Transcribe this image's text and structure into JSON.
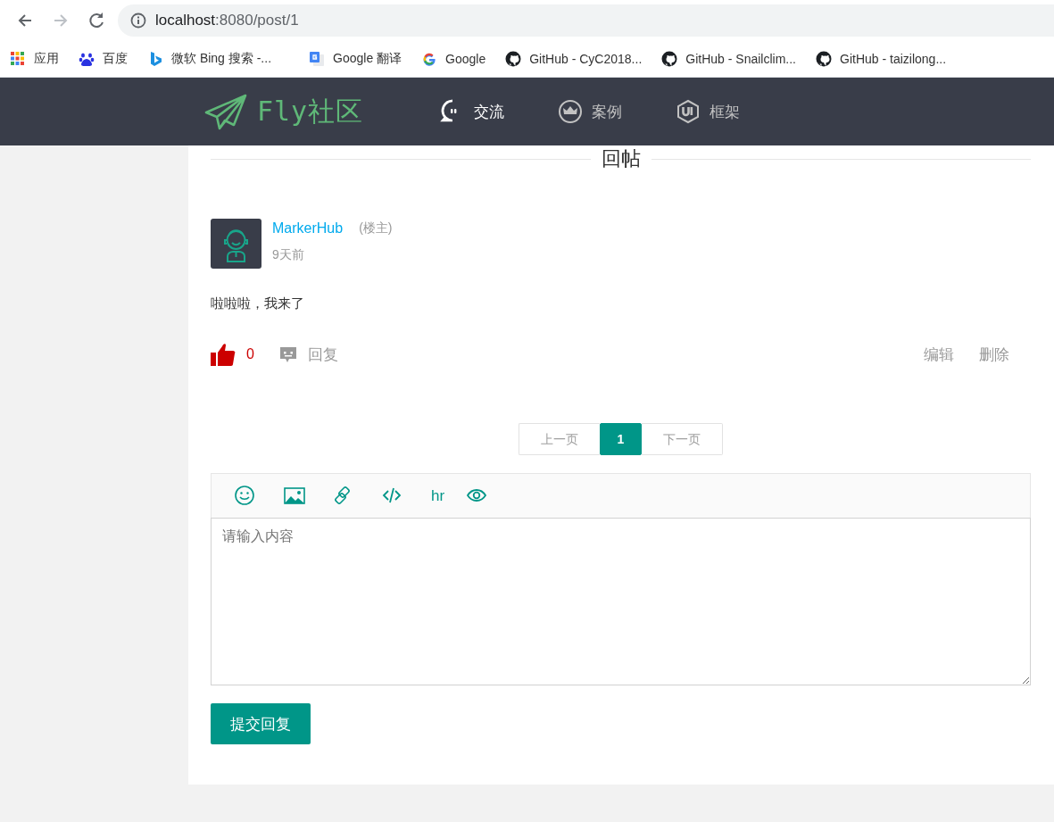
{
  "browser": {
    "nav_buttons": [
      {
        "kind": "back",
        "disabled": false
      },
      {
        "kind": "forward",
        "disabled": true
      },
      {
        "kind": "reload",
        "disabled": false
      }
    ],
    "url_host": "localhost",
    "url_rest": ":8080/post/1",
    "bookmarks": [
      {
        "kind": "apps",
        "label": "应用"
      },
      {
        "kind": "paw",
        "label": "百度"
      },
      {
        "kind": "bing",
        "label": "微软 Bing 搜索 -..."
      },
      {
        "kind": "translate",
        "label": "Google 翻译"
      },
      {
        "kind": "google",
        "label": "Google"
      },
      {
        "kind": "github",
        "label": "GitHub - CyC2018..."
      },
      {
        "kind": "github",
        "label": "GitHub - Snailclim..."
      },
      {
        "kind": "github",
        "label": "GitHub - taizilong..."
      }
    ]
  },
  "header": {
    "logo": "Fly社区",
    "nav": [
      {
        "kind": "chat",
        "label": "交流",
        "selected": true
      },
      {
        "kind": "crown",
        "label": "案例",
        "selected": false
      },
      {
        "kind": "ui",
        "label": "框架",
        "selected": false
      }
    ]
  },
  "section_title": "回帖",
  "comment": {
    "author": "MarkerHub",
    "badge": "(楼主)",
    "time": "9天前",
    "content": "啦啦啦，我来了",
    "likes": "0",
    "reply": "回复",
    "actions": [
      "编辑",
      "删除"
    ]
  },
  "pagination": {
    "prev": {
      "label": "上一页",
      "disabled": true
    },
    "pages": [
      {
        "label": "1",
        "selected": true
      }
    ],
    "next": {
      "label": "下一页",
      "disabled": true
    }
  },
  "editor": {
    "tools": [
      {
        "kind": "emoji"
      },
      {
        "kind": "image"
      },
      {
        "kind": "link"
      },
      {
        "kind": "code"
      },
      {
        "kind": "text",
        "label": "hr"
      },
      {
        "kind": "preview"
      }
    ],
    "placeholder": "请输入内容",
    "submit": "提交回复"
  }
}
